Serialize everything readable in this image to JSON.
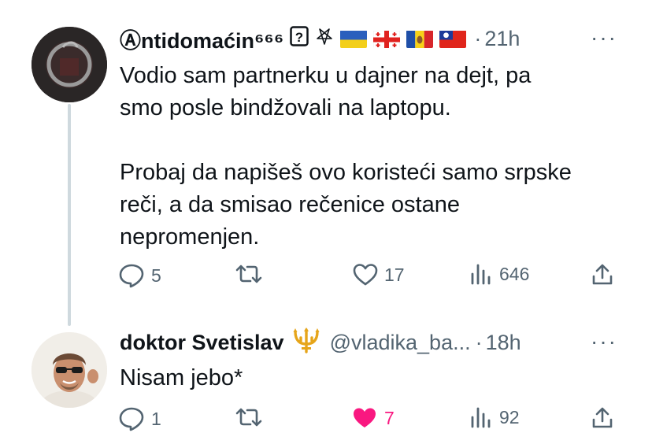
{
  "tweets": [
    {
      "display_name": "Ⓐntidomaćin⁶⁶⁶",
      "handle": "",
      "time": "21h",
      "body_lines": [
        "Vodio sam partnerku u dajner na dejt, pa",
        "smo posle bindžovali na laptopu.",
        "",
        "Probaj da napišeš ovo koristeći samo srpske",
        "reči, a da smisao rečenice ostane",
        "nepromenjen."
      ],
      "reply_count": "5",
      "retweet_count": "",
      "like_count": "17",
      "view_count": "646",
      "liked": false,
      "badges": [
        "question-box-icon",
        "pentagram-icon",
        "flag-ukraine",
        "flag-georgia",
        "flag-moldova",
        "flag-taiwan"
      ]
    },
    {
      "display_name": "doktor Svetislav",
      "handle": "@vladika_ba...",
      "time": "18h",
      "body_lines": [
        "Nisam jebo*"
      ],
      "reply_count": "1",
      "retweet_count": "",
      "like_count": "7",
      "view_count": "92",
      "liked": true,
      "badges": [
        "trident-icon"
      ]
    }
  ],
  "separator": "·",
  "more_label": "···",
  "colors": {
    "text": "#0f1419",
    "secondary": "#536471",
    "like": "#f91880",
    "thread_line": "#cfd9de"
  }
}
